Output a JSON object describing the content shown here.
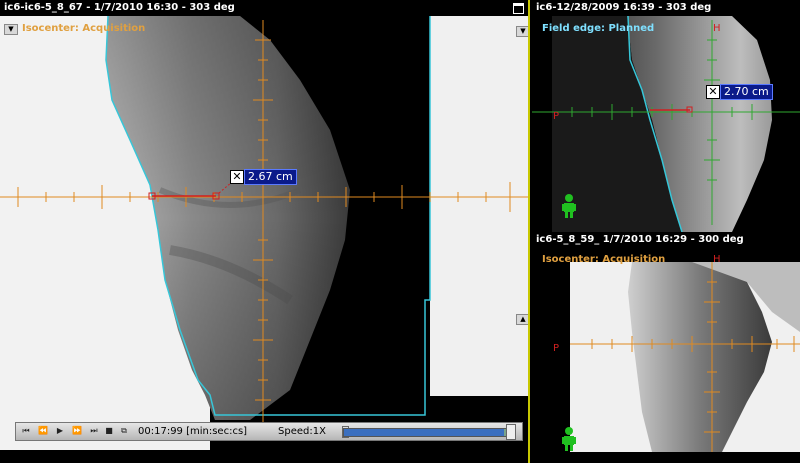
{
  "main": {
    "title": "ic6-ic6-5_8_67 - 1/7/2010 16:30 - 303 deg",
    "overlay": "Isocenter: Acquisition",
    "measurement": "2.67 cm",
    "close_icon": "close-x-icon",
    "player": {
      "time": "00:17:99 [min:sec:cs]",
      "speed": "Speed:1X",
      "progress": 0.94
    }
  },
  "top_right": {
    "title": "ic6-12/28/2009 16:39 - 303 deg",
    "overlay": "Field edge: Planned",
    "measurement": "2.70 cm",
    "label_h": "H",
    "label_p": "P"
  },
  "bottom_right": {
    "title": "ic6-5_8_59_ 1/7/2010 16:29 - 300 deg",
    "overlay": "Isocenter: Acquisition",
    "label_h": "H",
    "label_p": "P"
  },
  "colors": {
    "orange": "#e08a20",
    "cyan": "#37c6d8",
    "green": "#20c020",
    "border_yellow": "#c8c800"
  }
}
